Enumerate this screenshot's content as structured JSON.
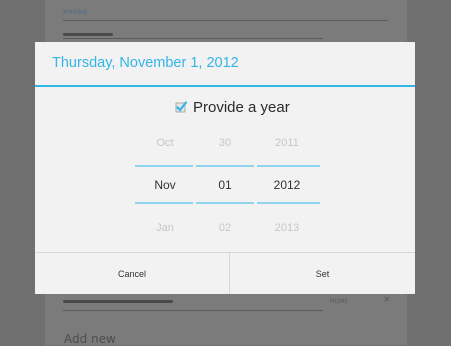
{
  "background": {
    "section_label": "PHONE",
    "phone_type": "HOME",
    "add_new_label": "Add new",
    "remove_glyph": "×"
  },
  "dialog": {
    "title": "Thursday, November 1, 2012",
    "provide_year_label": "Provide a year",
    "provide_year_checked": true,
    "picker": {
      "month": {
        "prev": "Oct",
        "current": "Nov",
        "next": "Jan"
      },
      "day": {
        "prev": "30",
        "current": "01",
        "next": "02"
      },
      "year": {
        "prev": "2011",
        "current": "2012",
        "next": "2013"
      }
    },
    "cancel_label": "Cancel",
    "set_label": "Set"
  },
  "colors": {
    "accent": "#33b5e5",
    "dialog_bg": "#f2f2f2",
    "dim_overlay": "#6f6f6f"
  }
}
